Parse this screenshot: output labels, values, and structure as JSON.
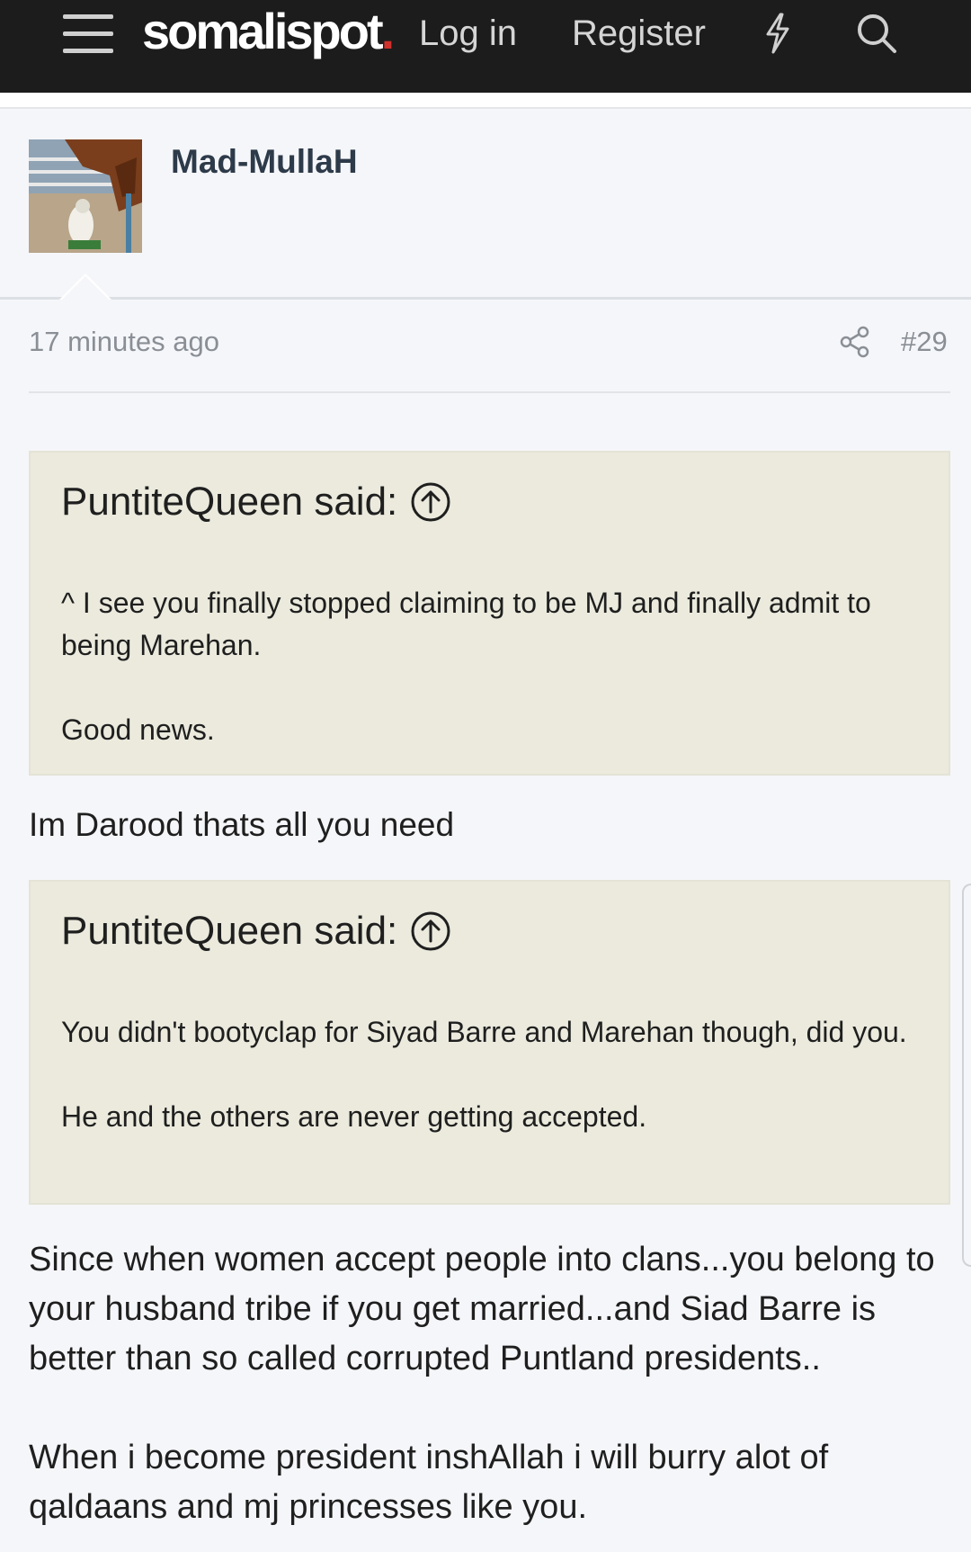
{
  "header": {
    "logo_text": "somalispot",
    "logo_dot": ".",
    "login_label": "Log in",
    "register_label": "Register",
    "icons": [
      "menu-icon",
      "bolt-icon",
      "search-icon"
    ]
  },
  "post": {
    "author": "Mad-MullaH",
    "time": "17 minutes ago",
    "number": "#29",
    "quotes": [
      {
        "header": "PuntiteQueen said:",
        "lines": [
          "^ I see you finally stopped claiming to be MJ and finally admit to being Marehan.",
          "Good news."
        ]
      },
      {
        "header": "PuntiteQueen said:",
        "lines": [
          "You didn't bootyclap for Siyad Barre and Marehan though, did you.",
          "He and the others are never getting accepted."
        ]
      }
    ],
    "reply_1": "Im Darood thats all you need",
    "reply_2": [
      "Since when women accept people into clans...you belong to your husband tribe if you get married...and Siad Barre is better than so called corrupted Puntland presidents..",
      "When i become president inshAllah i will burry alot of qaldaans and mj princesses like you."
    ]
  },
  "colors": {
    "header_bg": "#1c1c1c",
    "quote_bg": "#ebeadd",
    "username": "#2d3a49",
    "accent_dot": "#d0312d"
  }
}
